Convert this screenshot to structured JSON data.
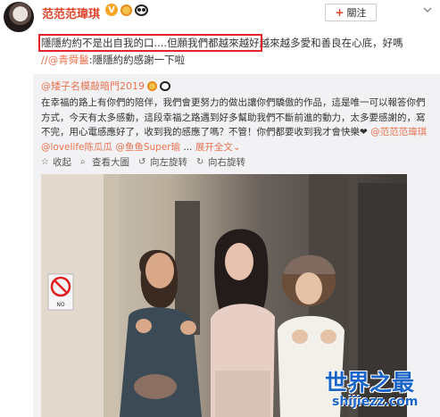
{
  "header": {
    "username": "范范范瑋琪",
    "badge_v": "V",
    "follow_label": "關注",
    "follow_plus": "+"
  },
  "post": {
    "highlighted": "隱隱約約不是出自我的口....但願我們都越來越好",
    "rest": "越來越多愛和善良在心底，好嗎",
    "mention_user": "//@青舜鬣",
    "mention_text": ":隱隱約約感謝一下啦"
  },
  "repost": {
    "user": "@矮子名模敲暗門2019",
    "body": "在幸福的路上有你們的陪伴，我們會更努力的做出讓你們驕傲的作品，這是唯一可以報答你們方式，今天有太多感動，這段幸福之路遇到好多幫助我們不斷前進的動力，太多要感謝的，寫不完，用心電感應好了，收到我的感應了嗎？不管！你們都要收到我才會快樂",
    "heart": "❤",
    "tag1": "@范范范瑋琪",
    "tag2": "@lovelife陈瓜瓜",
    "tag3": "@鱼鱼Super瑜",
    "expand": "展开全文",
    "expand_arrow": "⌄",
    "actions": [
      {
        "icon": "star-icon",
        "label": "收起"
      },
      {
        "icon": "magnify-icon",
        "label": "查看大圖"
      },
      {
        "icon": "rotate-left-icon",
        "label": "向左旋转"
      },
      {
        "icon": "rotate-right-icon",
        "label": "向右旋转"
      }
    ]
  },
  "photo": {
    "sign_text": "NO"
  },
  "watermark": {
    "title": "世界之最",
    "url": "shijiezz.com"
  },
  "colors": {
    "brand_red": "#e0442b",
    "link_orange": "#eb7350",
    "highlight_box": "#e5232b",
    "watermark_blue": "#1a64c8"
  }
}
